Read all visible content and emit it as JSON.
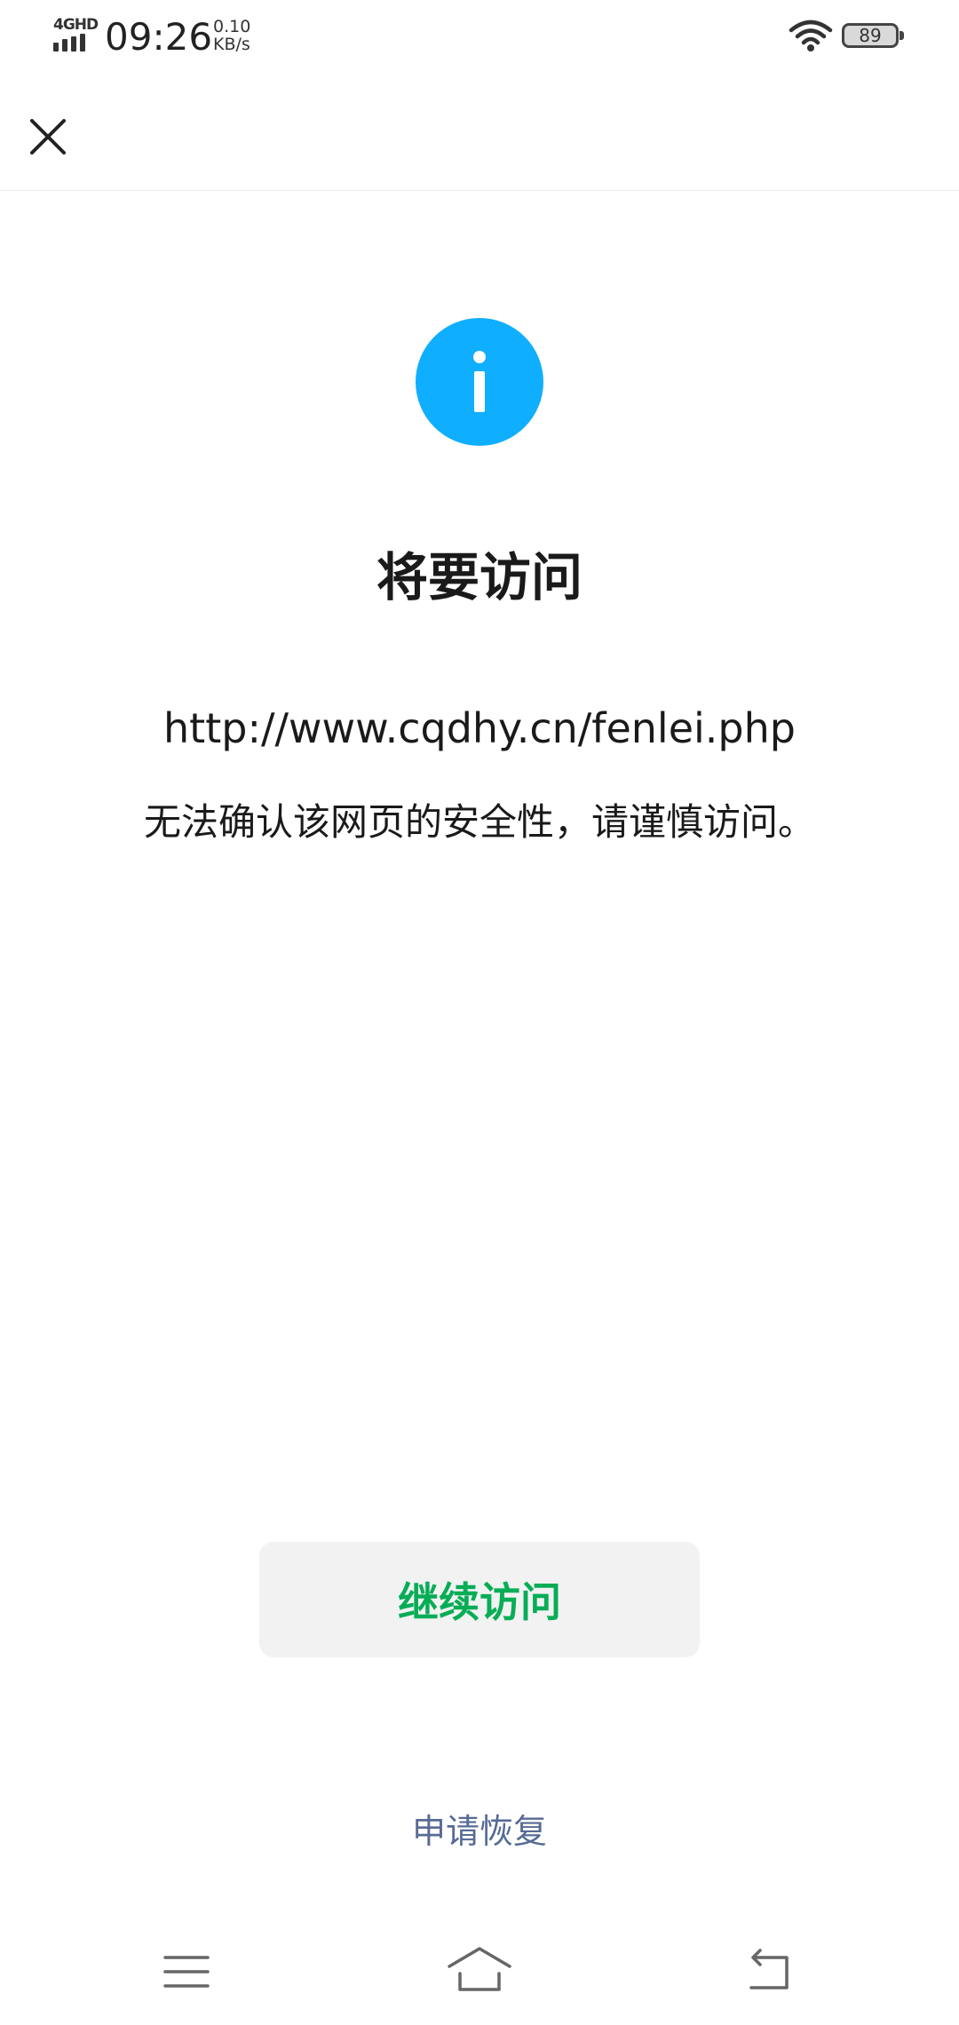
{
  "status_bar": {
    "network_type": "4GHD",
    "time": "09:26",
    "net_speed_value": "0.10",
    "net_speed_unit": "KB/s",
    "battery_level": "89"
  },
  "nav": {
    "close_icon": "close-icon"
  },
  "main": {
    "icon": "info-icon",
    "icon_color": "#10aeff",
    "title": "将要访问",
    "url": "http://www.cqdhy.cn/fenlei.php",
    "warning": "无法确认该网页的安全性，请谨慎访问。"
  },
  "actions": {
    "continue_label": "继续访问",
    "continue_color": "#07ad56",
    "restore_label": "申请恢复",
    "restore_color": "#576b95"
  },
  "system_nav": {
    "menu_icon": "menu-icon",
    "home_icon": "home-icon",
    "back_icon": "back-icon"
  }
}
